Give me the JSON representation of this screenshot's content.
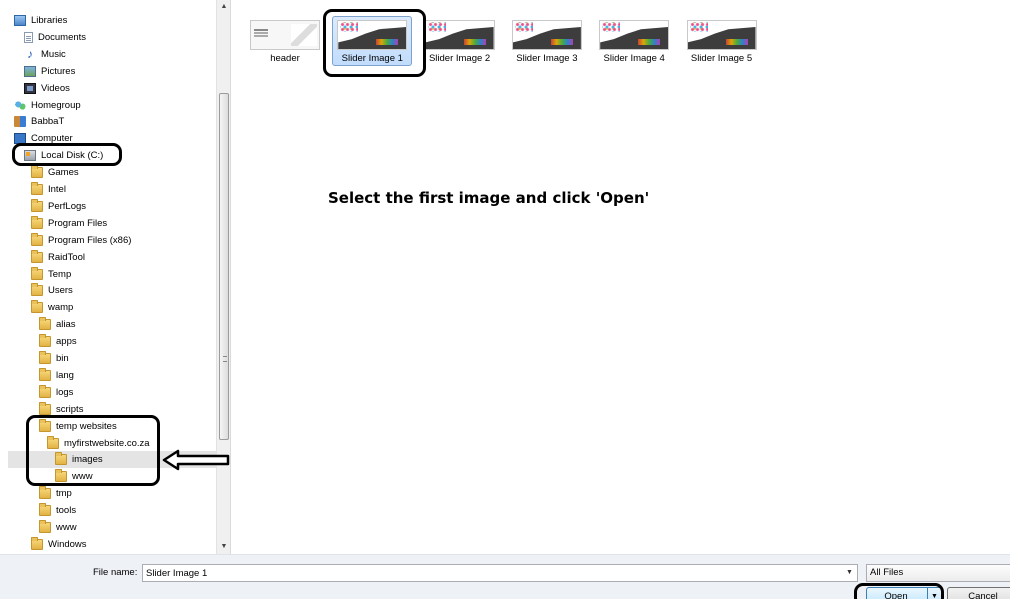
{
  "navigation": {
    "items": [
      {
        "label": "Libraries",
        "icon": "library-icon",
        "indent": 0
      },
      {
        "label": "Documents",
        "icon": "documents-icon",
        "indent": 1
      },
      {
        "label": "Music",
        "icon": "music-icon",
        "indent": 1
      },
      {
        "label": "Pictures",
        "icon": "pictures-icon",
        "indent": 1
      },
      {
        "label": "Videos",
        "icon": "videos-icon",
        "indent": 1
      },
      {
        "label": "Homegroup",
        "icon": "homegroup-icon",
        "indent": 0
      },
      {
        "label": "BabbaT",
        "icon": "user-icon",
        "indent": 0
      },
      {
        "label": "Computer",
        "icon": "computer-icon",
        "indent": 0
      },
      {
        "label": "Local Disk (C:)",
        "icon": "drive-icon",
        "indent": 1
      },
      {
        "label": "Games",
        "icon": "folder-icon",
        "indent": 2
      },
      {
        "label": "Intel",
        "icon": "folder-icon",
        "indent": 2
      },
      {
        "label": "PerfLogs",
        "icon": "folder-icon",
        "indent": 2
      },
      {
        "label": "Program Files",
        "icon": "folder-icon",
        "indent": 2
      },
      {
        "label": "Program Files (x86)",
        "icon": "folder-icon",
        "indent": 2
      },
      {
        "label": "RaidTool",
        "icon": "folder-icon",
        "indent": 2
      },
      {
        "label": "Temp",
        "icon": "folder-icon",
        "indent": 2
      },
      {
        "label": "Users",
        "icon": "folder-icon",
        "indent": 2
      },
      {
        "label": "wamp",
        "icon": "folder-icon",
        "indent": 2
      },
      {
        "label": "alias",
        "icon": "folder-icon",
        "indent": 3
      },
      {
        "label": "apps",
        "icon": "folder-icon",
        "indent": 3
      },
      {
        "label": "bin",
        "icon": "folder-icon",
        "indent": 3
      },
      {
        "label": "lang",
        "icon": "folder-icon",
        "indent": 3
      },
      {
        "label": "logs",
        "icon": "folder-icon",
        "indent": 3
      },
      {
        "label": "scripts",
        "icon": "folder-icon",
        "indent": 3
      },
      {
        "label": "temp websites",
        "icon": "folder-icon",
        "indent": 3
      },
      {
        "label": "myfirstwebsite.co.za",
        "icon": "folder-icon",
        "indent": 4
      },
      {
        "label": "images",
        "icon": "folder-icon",
        "indent": 5,
        "selected": true
      },
      {
        "label": "www",
        "icon": "folder-icon",
        "indent": 5
      },
      {
        "label": "tmp",
        "icon": "folder-icon",
        "indent": 3
      },
      {
        "label": "tools",
        "icon": "folder-icon",
        "indent": 3
      },
      {
        "label": "www",
        "icon": "folder-icon",
        "indent": 3
      },
      {
        "label": "Windows",
        "icon": "folder-icon",
        "indent": 2
      }
    ]
  },
  "files": [
    {
      "label": "header",
      "kind": "header",
      "selected": false
    },
    {
      "label": "Slider Image 1",
      "kind": "slider",
      "selected": true
    },
    {
      "label": "Slider Image 2",
      "kind": "slider",
      "selected": false
    },
    {
      "label": "Slider Image 3",
      "kind": "slider",
      "selected": false
    },
    {
      "label": "Slider Image 4",
      "kind": "slider",
      "selected": false
    },
    {
      "label": "Slider Image 5",
      "kind": "slider",
      "selected": false
    }
  ],
  "instruction": "Select the first image and click 'Open'",
  "bottom_bar": {
    "file_name_label": "File name:",
    "file_name_value": "Slider Image 1",
    "file_type": "All Files",
    "open_label": "Open",
    "cancel_label": "Cancel"
  },
  "colors": {
    "selection_bg": "#c1dcfc",
    "selection_border": "#7da2ce",
    "annotation": "#000000",
    "folder": "#e2b345"
  }
}
